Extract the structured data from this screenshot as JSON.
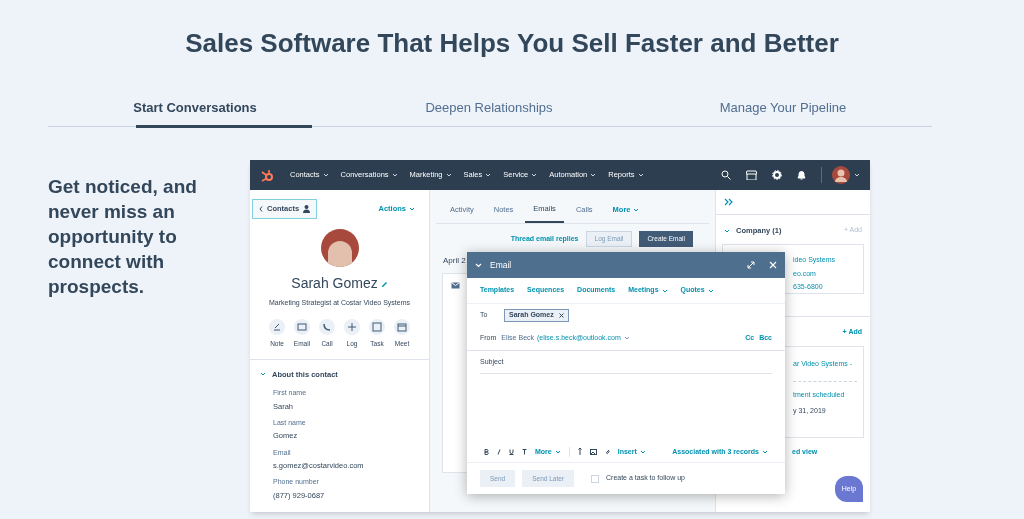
{
  "heading": "Sales Software That Helps You Sell Faster and Better",
  "tabs": [
    {
      "label": "Start Conversations",
      "selected": true
    },
    {
      "label": "Deepen Relationships",
      "selected": false
    },
    {
      "label": "Manage Your Pipeline",
      "selected": false
    }
  ],
  "intro": "Get noticed, and never miss an opportunity to connect with prospects.",
  "app": {
    "nav": [
      "Contacts",
      "Conversations",
      "Marketing",
      "Sales",
      "Service",
      "Automation",
      "Reports"
    ],
    "contact": {
      "back": "Contacts",
      "actions": "Actions",
      "name": "Sarah Gomez",
      "subtitle": "Marketing Strategist at Costar Video Systems",
      "quick_actions": [
        "Note",
        "Email",
        "Call",
        "Log",
        "Task",
        "Meet"
      ],
      "about": {
        "title": "About this contact",
        "expanded": true,
        "fields": [
          {
            "label": "First name",
            "value": "Sarah"
          },
          {
            "label": "Last name",
            "value": "Gomez"
          },
          {
            "label": "Email",
            "value": "s.gomez@costarvideo.com"
          },
          {
            "label": "Phone number",
            "value": "(877) 929-0687"
          }
        ]
      }
    },
    "activity": {
      "tabs": [
        {
          "label": "Activity",
          "selected": false
        },
        {
          "label": "Notes",
          "selected": false
        },
        {
          "label": "Emails",
          "selected": true
        },
        {
          "label": "Calls",
          "selected": false
        }
      ],
      "more": "More",
      "thread_link": "Thread email replies",
      "log_button": "Log Email",
      "create_button": "Create Email",
      "date": "April 2"
    },
    "sidebar": {
      "company": {
        "title": "Company (1)",
        "add": "+ Add",
        "expanded": true,
        "lines": [
          "ideo Systems",
          "eo.com",
          "635-6800"
        ]
      },
      "deals": {
        "add": "+ Add",
        "lines": [
          "ar Video Systems -",
          "tment scheduled",
          "y 31, 2019"
        ],
        "link": "ed view"
      }
    },
    "email": {
      "title": "Email",
      "toolbar": [
        {
          "label": "Templates",
          "dropdown": false
        },
        {
          "label": "Sequences",
          "dropdown": false
        },
        {
          "label": "Documents",
          "dropdown": false
        },
        {
          "label": "Meetings",
          "dropdown": true
        },
        {
          "label": "Quotes",
          "dropdown": true
        }
      ],
      "to_label": "To",
      "recipient": "Sarah Gomez",
      "from_label": "From",
      "from_name": "Elise Beck",
      "from_address": "(elise.s.beck@outlook.com",
      "cc": "Cc",
      "bcc": "Bcc",
      "subject_label": "Subject",
      "format_menus": [
        "More",
        "Insert"
      ],
      "associated": "Associated with 3 records",
      "send": {
        "label": "Send",
        "disabled": true
      },
      "send_later": {
        "label": "Send Later",
        "disabled": true
      },
      "follow_up": {
        "label": "Create a task to follow up",
        "checked": false
      }
    },
    "help": "Help"
  }
}
